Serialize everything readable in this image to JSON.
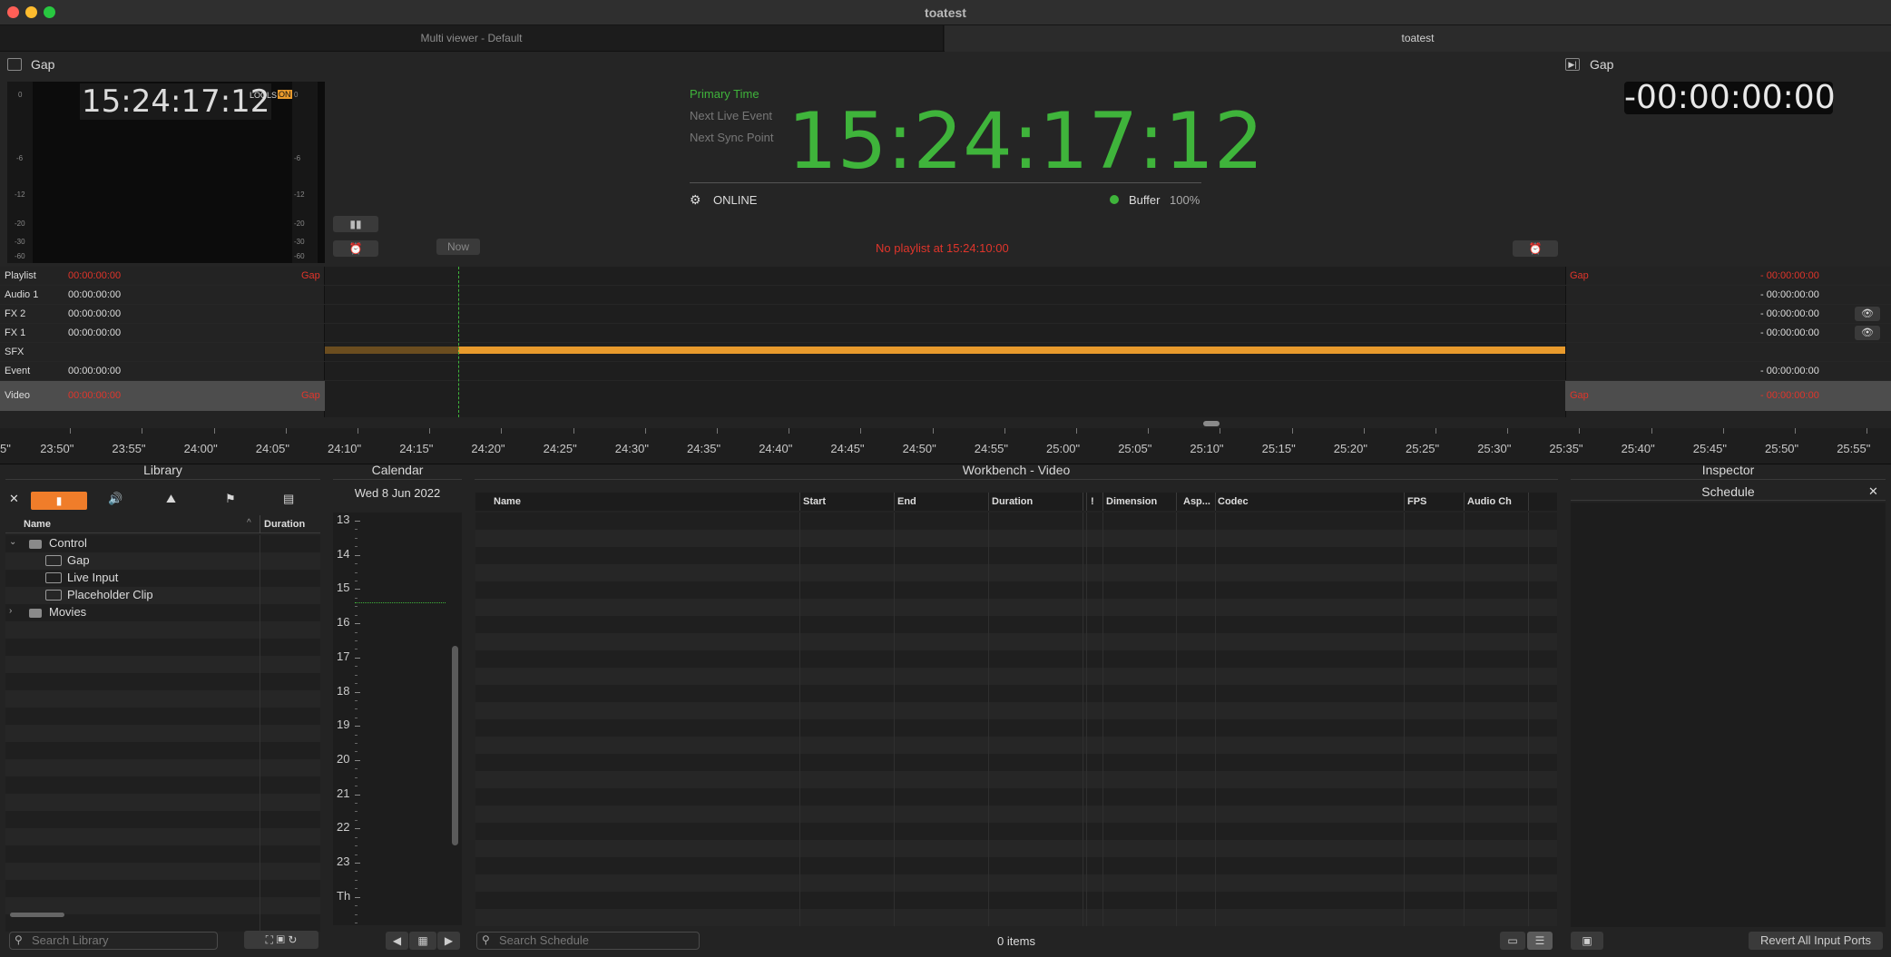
{
  "window": {
    "title": "toatest"
  },
  "tabs": [
    "Multi viewer - Default",
    "toatest"
  ],
  "left_player": {
    "label": "Gap",
    "preview_time": "15:24:17:12",
    "badge_left": "LOOLS",
    "badge_on": "ON",
    "meter_scale": [
      "0",
      "-6",
      "-12",
      "-20",
      "-30",
      "-60"
    ]
  },
  "right_player": {
    "label": "Gap",
    "countdown": "-00:00:00:00"
  },
  "clock": {
    "primary_time_label": "Primary Time",
    "next_live_label": "Next Live Event",
    "next_sync_label": "Next Sync Point",
    "time": "15:24:17:12",
    "status": "ONLINE",
    "buffer_label": "Buffer",
    "buffer_value": "100%"
  },
  "timeline": {
    "now_button": "Now",
    "message": "No playlist at 15:24:10:00",
    "tracks": [
      {
        "name": "Playlist",
        "time": "00:00:00:00",
        "gap": "Gap",
        "rgap": "Gap",
        "rtime": "- 00:00:00:00",
        "red": true
      },
      {
        "name": "Audio 1",
        "time": "00:00:00:00",
        "gap": "",
        "rgap": "",
        "rtime": "- 00:00:00:00",
        "red": false
      },
      {
        "name": "FX 2",
        "time": "00:00:00:00",
        "gap": "",
        "rgap": "",
        "rtime": "- 00:00:00:00",
        "red": false
      },
      {
        "name": "FX 1",
        "time": "00:00:00:00",
        "gap": "",
        "rgap": "",
        "rtime": "- 00:00:00:00",
        "red": false
      },
      {
        "name": "SFX",
        "time": "",
        "gap": "",
        "rgap": "",
        "rtime": "",
        "red": false
      },
      {
        "name": "Event",
        "time": "00:00:00:00",
        "gap": "",
        "rgap": "",
        "rtime": "- 00:00:00:00",
        "red": false
      },
      {
        "name": "Video",
        "time": "00:00:00:00",
        "gap": "Gap",
        "rgap": "Gap",
        "rtime": "- 00:00:00:00",
        "red": true
      }
    ],
    "ruler_ticks": [
      "5\"",
      "23:50\"",
      "23:55\"",
      "24:00\"",
      "24:05\"",
      "24:10\"",
      "24:15\"",
      "24:20\"",
      "24:25\"",
      "24:30\"",
      "24:35\"",
      "24:40\"",
      "24:45\"",
      "24:50\"",
      "24:55\"",
      "25:00\"",
      "25:05\"",
      "25:10\"",
      "25:15\"",
      "25:20\"",
      "25:25\"",
      "25:30\"",
      "25:35\"",
      "25:40\"",
      "25:45\"",
      "25:50\"",
      "25:55\""
    ]
  },
  "library": {
    "title": "Library",
    "col_name": "Name",
    "col_duration": "Duration",
    "items": [
      {
        "label": "Control",
        "level": 0,
        "kind": "folder",
        "expanded": true
      },
      {
        "label": "Gap",
        "level": 1,
        "kind": "clip"
      },
      {
        "label": "Live Input",
        "level": 1,
        "kind": "clip"
      },
      {
        "label": "Placeholder Clip",
        "level": 1,
        "kind": "clip"
      },
      {
        "label": "Movies",
        "level": 0,
        "kind": "folder",
        "expanded": false
      }
    ],
    "search_placeholder": "Search Library"
  },
  "calendar": {
    "title": "Calendar",
    "date": "Wed 8 Jun 2022",
    "hours": [
      "13",
      "14",
      "15",
      "16",
      "17",
      "18",
      "19",
      "20",
      "21",
      "22",
      "23",
      "Th"
    ]
  },
  "workbench": {
    "title": "Workbench - Video",
    "columns": [
      "Name",
      "Start",
      "End",
      "Duration",
      "!",
      "Dimension",
      "Asp...",
      "Codec",
      "FPS",
      "Audio Ch"
    ],
    "search_placeholder": "Search Schedule",
    "item_count": "0 items"
  },
  "inspector": {
    "title": "Inspector",
    "subtitle": "Schedule",
    "revert_button": "Revert All Input Ports"
  },
  "colors": {
    "green": "#3fb43b",
    "red": "#e0352b",
    "orange": "#e89a2c",
    "accent_tab": "#f07d2a"
  }
}
